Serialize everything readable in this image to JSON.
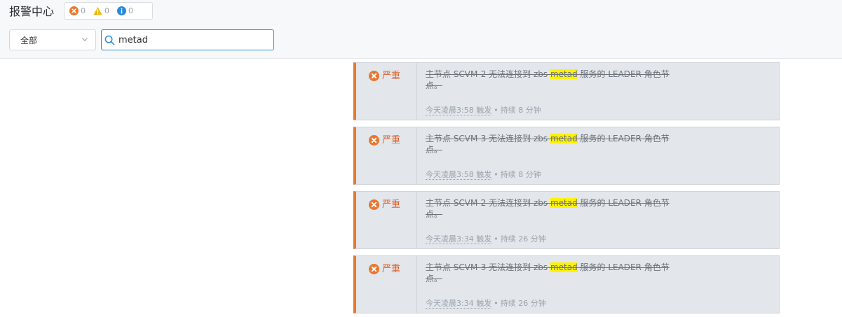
{
  "header": {
    "title": "报警中心",
    "counts": {
      "critical": "0",
      "warning": "0",
      "info": "0"
    }
  },
  "filter": {
    "select_value": "全部",
    "search_value": "metad"
  },
  "alerts": [
    {
      "severity": "严重",
      "text_before": "主节点 SCVM-2 无法连接到 zbs ",
      "highlight": "metad",
      "text_after": " 服务的 LEADER 角色节点。",
      "time": "今天凌晨3:58 触发",
      "separator": "•",
      "duration": "持续 8 分钟"
    },
    {
      "severity": "严重",
      "text_before": "主节点 SCVM-3 无法连接到 zbs ",
      "highlight": "metad",
      "text_after": " 服务的 LEADER 角色节点。",
      "time": "今天凌晨3:58 触发",
      "separator": "•",
      "duration": "持续 8 分钟"
    },
    {
      "severity": "严重",
      "text_before": "主节点 SCVM-2 无法连接到 zbs ",
      "highlight": "metad",
      "text_after": " 服务的 LEADER 角色节点。",
      "time": "今天凌晨3:34 触发",
      "separator": "•",
      "duration": "持续 26 分钟"
    },
    {
      "severity": "严重",
      "text_before": "主节点 SCVM-3 无法连接到 zbs ",
      "highlight": "metad",
      "text_after": " 服务的 LEADER 角色节点。",
      "time": "今天凌晨3:34 触发",
      "separator": "•",
      "duration": "持续 26 分钟"
    }
  ]
}
